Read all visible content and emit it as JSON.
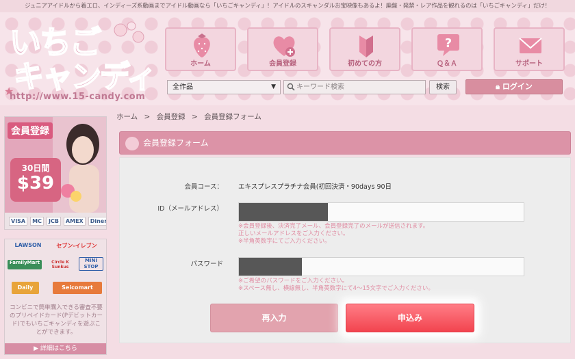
{
  "top_banner": "ジュニアアイドルから着エロ、インディーズ系動画までアイドル動画なら「いちごキャンディ」！アイドルのスキャンダルお宝映像もあるよ！廃盤・発禁・レア作品を観れるのは「いちごキャンディ」だけ！",
  "logo": {
    "line1": "いちご",
    "line2": "キャンディ",
    "url": "http://www.15-candy.com"
  },
  "nav": {
    "items": [
      {
        "label": "ホーム",
        "icon": "strawberry-icon"
      },
      {
        "label": "会員登録",
        "icon": "heart-plus-icon"
      },
      {
        "label": "初めての方",
        "icon": "beginner-mark-icon"
      },
      {
        "label": "Ｑ＆Ａ",
        "icon": "speech-question-icon"
      },
      {
        "label": "サポート",
        "icon": "mail-icon"
      }
    ]
  },
  "search": {
    "category": "全作品",
    "placeholder": "キーワード検索",
    "button": "検索",
    "login": "ログイン"
  },
  "breadcrumb": {
    "home": "ホーム",
    "sep1": ">",
    "register": "会員登録",
    "sep2": ">",
    "current": "会員登録フォーム"
  },
  "form": {
    "title": "会員登録フォーム",
    "course_label": "会員コース：",
    "course_value": "エキスプレスプラチナ会員(初回決済・90days 90日",
    "email_label": "ID（メールアドレス）",
    "email_notes": [
      "※会員登録後、決済完了メール、会員登録完了のメールが送信されます。",
      "正しいメールアドレスをご入力ください。",
      "※半角英数字にてご入力ください。"
    ],
    "password_label": "パスワード",
    "password_notes": [
      "※ご希望のパスワードをご入力ください。",
      "※スペース無し、横線無し、半角英数字にて4〜15文字でご入力ください。"
    ],
    "reset_button": "再入力",
    "submit_button": "申込み"
  },
  "sidebar": {
    "banner1": {
      "badge": "会員登録",
      "days": "30日間",
      "price": "$39",
      "cards": [
        "VISA",
        "MC",
        "JCB",
        "AMEX",
        "Diners"
      ]
    },
    "banner2": {
      "stores": [
        "LAWSON",
        "セブン-イレブン",
        "FamilyMart",
        "Circle K Sunkus",
        "MINI STOP",
        "Daily",
        "Seicomart"
      ],
      "description": "コンビニで簡単購入できる審査不要のプリペイドカード(Pデビットカード)でもいちごキャンディを遊ぶことができます。",
      "more": "▶ 詳細はこちら"
    }
  }
}
